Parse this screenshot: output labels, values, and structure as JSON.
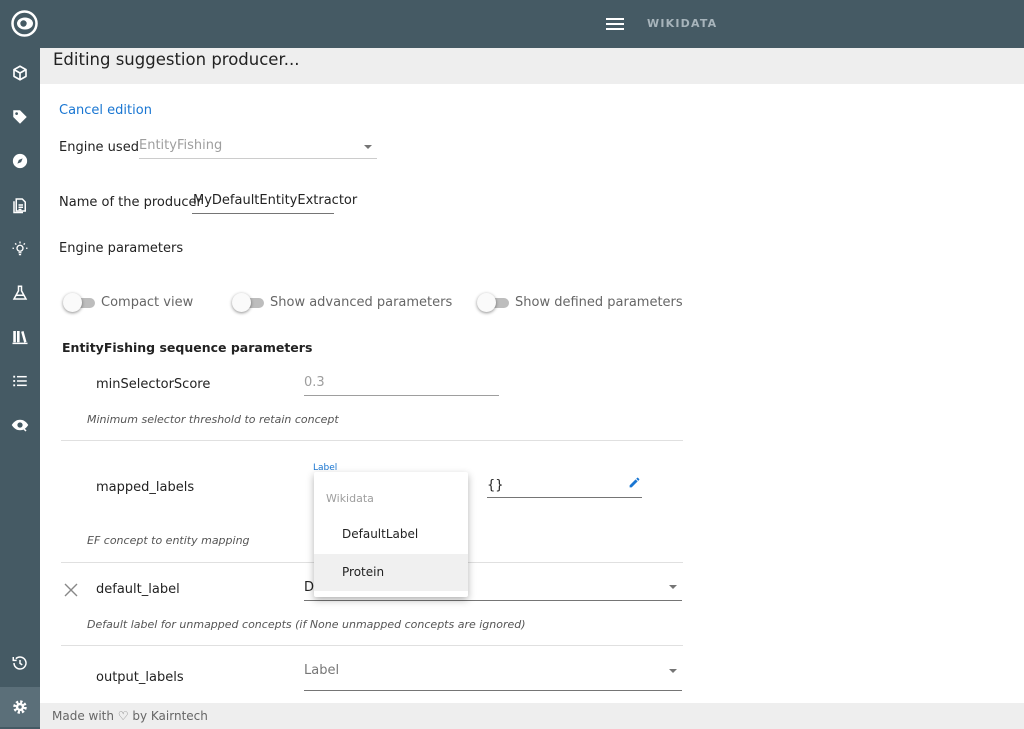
{
  "topbar": {
    "brand": "WIKIDATA"
  },
  "sidebar": {
    "icons": [
      "cube-icon",
      "tag-icon",
      "compass-icon",
      "document-icon",
      "lightbulb-icon",
      "flask-icon",
      "library-icon",
      "list-icon",
      "eye-icon",
      "history-icon",
      "gear-icon"
    ]
  },
  "page": {
    "title": "Editing suggestion producer..."
  },
  "form": {
    "cancel_label": "Cancel edition",
    "engine_label": "Engine used",
    "engine_value": "EntityFishing",
    "name_label": "Name of the producer",
    "name_value": "MyDefaultEntityExtractor",
    "engine_params_label": "Engine parameters"
  },
  "toggles": {
    "compact_view": "Compact view",
    "show_advanced": "Show advanced parameters",
    "show_defined": "Show defined parameters"
  },
  "params": {
    "section_title": "EntityFishing sequence parameters",
    "min_selector_score": {
      "name": "minSelectorScore",
      "placeholder": "0.3",
      "description": "Minimum selector threshold to retain concept"
    },
    "mapped_labels": {
      "name": "mapped_labels",
      "field_label": "Label",
      "value": "{}",
      "description": "EF concept to entity mapping"
    },
    "default_label": {
      "name": "default_label",
      "value_partial": "D",
      "description": "Default label for unmapped concepts (if None unmapped concepts are ignored)"
    },
    "output_labels": {
      "name": "output_labels",
      "placeholder": "Label"
    }
  },
  "dropdown": {
    "group": "Wikidata",
    "options": [
      "DefaultLabel",
      "Protein"
    ]
  },
  "footer": {
    "text": "Made with ♡ by Kairntech"
  },
  "colors": {
    "sidebar": "#455a64",
    "link": "#1976d2",
    "band": "#eeeeee"
  }
}
